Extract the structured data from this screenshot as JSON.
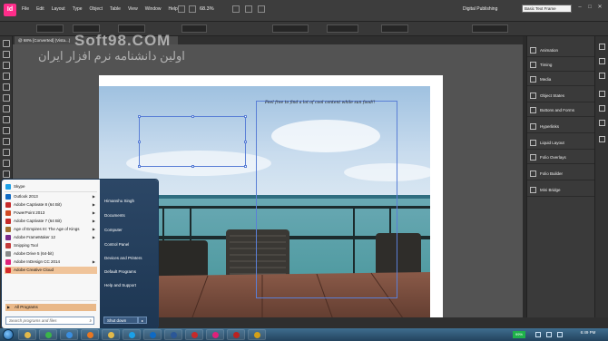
{
  "menubar": {
    "app_logo": "Id",
    "menus": [
      "File",
      "Edit",
      "Layout",
      "Type",
      "Object",
      "Table",
      "View",
      "Window",
      "Help"
    ],
    "zoom": "68.3%",
    "workspace": "Digital Publishing",
    "search_value": "Basic Text Frame"
  },
  "document": {
    "tab_label": "@ 68% [Converted] (Vista...)",
    "caption": "Feel free to find a lot of cool content while sun food!!"
  },
  "watermark": {
    "title": "Soft98.COM",
    "subtitle": "اولین دانشنامه نرم افزار ایران"
  },
  "right_panel": {
    "items": [
      {
        "label": "Animation",
        "icon": "animation-icon"
      },
      {
        "label": "Timing",
        "icon": "timing-icon"
      },
      {
        "label": "Media",
        "icon": "media-icon"
      },
      {
        "label": "Object States",
        "icon": "object-states-icon"
      },
      {
        "label": "Buttons and Forms",
        "icon": "buttons-forms-icon"
      },
      {
        "label": "Hyperlinks",
        "icon": "hyperlinks-icon"
      },
      {
        "label": "Liquid Layout",
        "icon": "liquid-layout-icon"
      },
      {
        "label": "Folio Overlays",
        "icon": "folio-overlays-icon"
      },
      {
        "label": "Folio Builder",
        "icon": "folio-builder-icon"
      },
      {
        "label": "Mini Bridge",
        "icon": "mini-bridge-icon"
      }
    ]
  },
  "start_menu": {
    "pinned": [
      {
        "label": "Skype",
        "color": "#1aa0e8",
        "arrow": false
      },
      {
        "label": "Outlook 2013",
        "color": "#0f6ac4",
        "arrow": true
      },
      {
        "label": "Adobe Captivate 8 (64 Bit)",
        "color": "#c62a2a",
        "arrow": true
      },
      {
        "label": "PowerPoint 2013",
        "color": "#d04a24",
        "arrow": true
      },
      {
        "label": "Adobe Captivate 7 (64 Bit)",
        "color": "#c62a2a",
        "arrow": true
      },
      {
        "label": "Age of Empires III: The Age of Kings",
        "color": "#a07030",
        "arrow": true
      },
      {
        "label": "Adobe FrameMaker 12",
        "color": "#7a2a8a",
        "arrow": true
      },
      {
        "label": "Snipping Tool",
        "color": "#c43a3a",
        "arrow": false
      },
      {
        "label": "Adobe Drive 5 (64-bit)",
        "color": "#8a8a8a",
        "arrow": false
      },
      {
        "label": "Adobe InDesign CC 2014",
        "color": "#e0217a",
        "arrow": true
      },
      {
        "label": "Adobe Creative Cloud",
        "color": "#d52a2a",
        "arrow": false
      }
    ],
    "all_programs": "All Programs",
    "search_placeholder": "Search programs and files",
    "right_items": [
      "Himanshu Singh",
      "Documents",
      "Computer",
      "Control Panel",
      "Devices and Printers",
      "Default Programs",
      "Help and Support"
    ],
    "shutdown": "Shut down",
    "shutdown_arrow": "▸"
  },
  "taskbar": {
    "battery": "99%",
    "time": "6:49 PM",
    "apps": [
      {
        "name": "explorer",
        "color": "#e2b94a"
      },
      {
        "name": "chrome",
        "color": "#3bb54a"
      },
      {
        "name": "ie",
        "color": "#3a8ee0"
      },
      {
        "name": "media",
        "color": "#e87722"
      },
      {
        "name": "files",
        "color": "#e2b94a"
      },
      {
        "name": "skype",
        "color": "#1aa0e8"
      },
      {
        "name": "outlook",
        "color": "#0f6ac4"
      },
      {
        "name": "word",
        "color": "#2b5797"
      },
      {
        "name": "captivate",
        "color": "#c62a2a"
      },
      {
        "name": "indesign",
        "color": "#e0217a"
      },
      {
        "name": "acrobat",
        "color": "#b22"
      },
      {
        "name": "app12",
        "color": "#d4a017"
      }
    ]
  },
  "colors": {
    "indesign_brand": "#ff2d8a",
    "selection": "#5a7fd6",
    "start_highlight": "#f0c49a"
  }
}
